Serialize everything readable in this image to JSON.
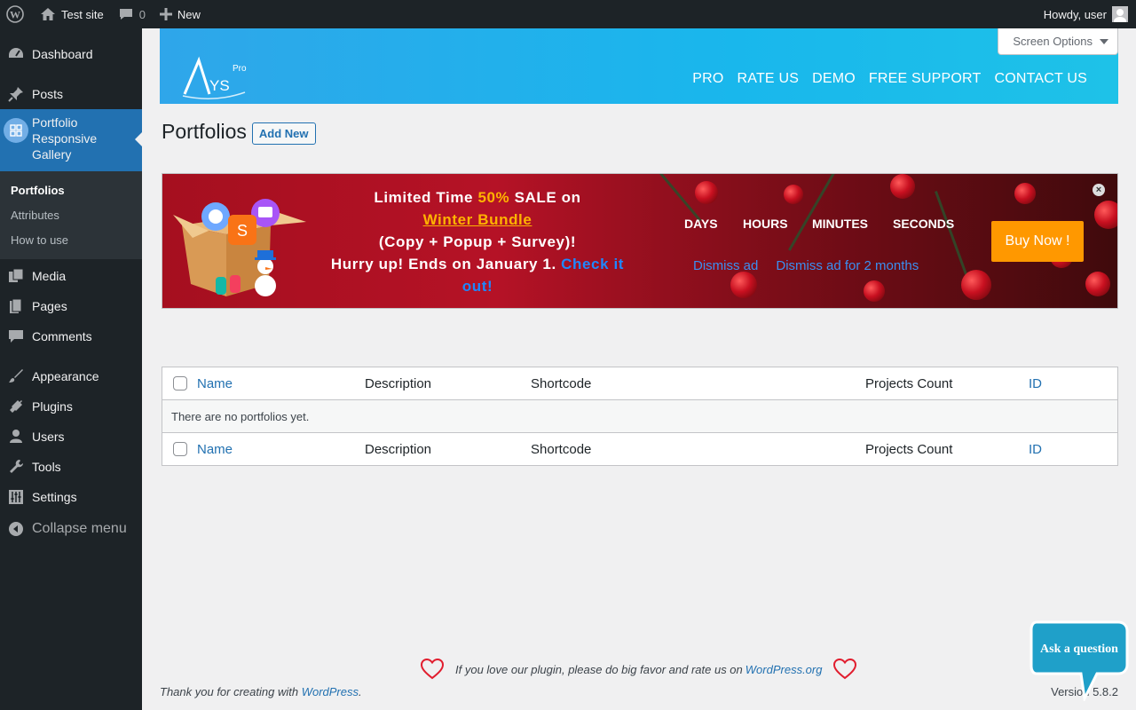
{
  "adminbar": {
    "site_name": "Test site",
    "comments_count": "0",
    "new_label": "New",
    "howdy": "Howdy, user"
  },
  "sidebar": {
    "dashboard": "Dashboard",
    "posts": "Posts",
    "portfolio": "Portfolio Responsive Gallery",
    "submenu": [
      "Portfolios",
      "Attributes",
      "How to use"
    ],
    "media": "Media",
    "pages": "Pages",
    "comments": "Comments",
    "appearance": "Appearance",
    "plugins": "Plugins",
    "users": "Users",
    "tools": "Tools",
    "settings": "Settings",
    "collapse": "Collapse menu"
  },
  "header": {
    "logo_text": "YS",
    "logo_pro": "Pro",
    "links": [
      "PRO",
      "RATE US",
      "DEMO",
      "FREE SUPPORT",
      "CONTACT US"
    ],
    "screen_options": "Screen Options"
  },
  "page": {
    "title": "Portfolios",
    "add_new": "Add New"
  },
  "sale": {
    "line1_a": "Limited Time ",
    "line1_pct": "50%",
    "line1_b": " SALE on",
    "bundle": "Winter Bundle",
    "line3": "(Copy + Popup + Survey)!",
    "line4": "Hurry up! Ends on January 1. ",
    "check": "Check it out!",
    "countdown": [
      "DAYS",
      "HOURS",
      "MINUTES",
      "SECONDS"
    ],
    "dismiss": "Dismiss ad",
    "dismiss_months": "Dismiss ad for 2 months",
    "buy_now": "Buy Now !",
    "colors": {
      "accent": "#ffb300",
      "button": "#ff9800",
      "link": "#1e88ff"
    }
  },
  "table": {
    "columns": [
      "Name",
      "Description",
      "Shortcode",
      "Projects Count",
      "ID"
    ],
    "empty": "There are no portfolios yet."
  },
  "footer": {
    "rate_text": "If you love our plugin, please do big favor and rate us on ",
    "rate_link": "WordPress.org",
    "thanks_text": "Thank you for creating with ",
    "thanks_link": "WordPress",
    "version": "Version 5.8.2",
    "ask": "Ask a question"
  }
}
